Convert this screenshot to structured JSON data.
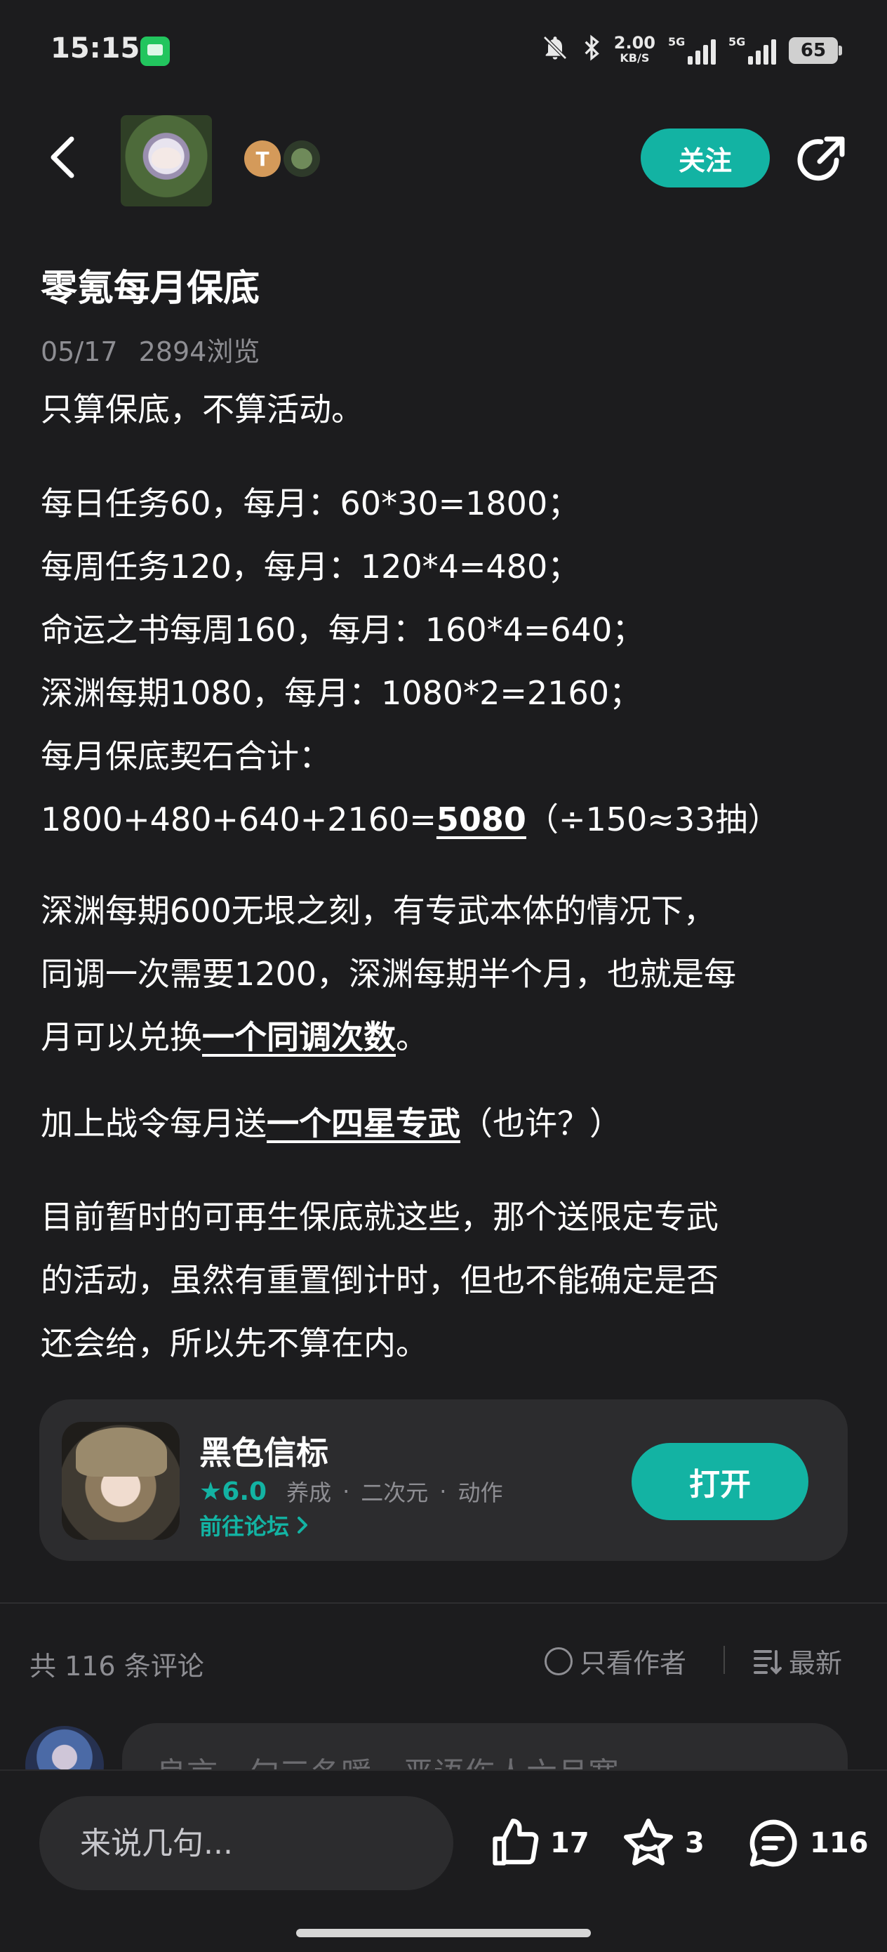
{
  "status_bar": {
    "time": "15:15",
    "net_speed_value": "2.00",
    "net_speed_unit": "KB/S",
    "signal_1_label": "5G",
    "signal_2_label": "5G",
    "battery": "65"
  },
  "header": {
    "follow_label": "关注",
    "badge_letter": "T"
  },
  "post": {
    "title": "零氪每月保底",
    "date": "05/17",
    "views": "2894浏览",
    "paragraphs": {
      "p1": "只算保底，不算活动。",
      "p2_l1": "每日任务60，每月：60*30=1800；",
      "p2_l2": "每周任务120，每月：120*4=480；",
      "p2_l3": "命运之书每周160，每月：160*4=640；",
      "p2_l4": "深渊每期1080，每月：1080*2=2160；",
      "p2_l5": "每月保底契石合计：",
      "p2_l6_pre": "1800+480+640+2160=",
      "p2_l6_bold": "5080",
      "p2_l6_post": "（÷150≈33抽）",
      "p3_l1": "深渊每期600无垠之刻，有专武本体的情况下，",
      "p3_l2": "同调一次需要1200，深渊每期半个月，也就是每",
      "p3_l3_pre": "月可以兑换",
      "p3_l3_bold": "一个同调次数",
      "p3_l3_post": "。",
      "p4_pre": "加上战令每月送",
      "p4_bold": "一个四星专武",
      "p4_post": "（也许？）",
      "p5_l1": "目前暂时的可再生保底就这些，那个送限定专武",
      "p5_l2": "的活动，虽然有重置倒计时，但也不能确定是否",
      "p5_l3": "还会给，所以先不算在内。"
    }
  },
  "app_card": {
    "name": "黑色信标",
    "rating": "6.0",
    "tags": [
      "养成",
      "二次元",
      "动作"
    ],
    "link_label": "前往论坛",
    "open_label": "打开"
  },
  "comments": {
    "count_label": "共 116 条评论",
    "filter_author_label": "只看作者",
    "sort_label": "最新",
    "preview_text": "良言一句三冬暖，恶语伤人六月寒"
  },
  "bottom_bar": {
    "input_placeholder": "来说几句...",
    "likes": "17",
    "favorites": "3",
    "comments": "116"
  },
  "colors": {
    "accent": "#13b3a3",
    "background": "#1c1c1e",
    "card": "#2c2c2e",
    "muted_text": "#8e8e93"
  }
}
